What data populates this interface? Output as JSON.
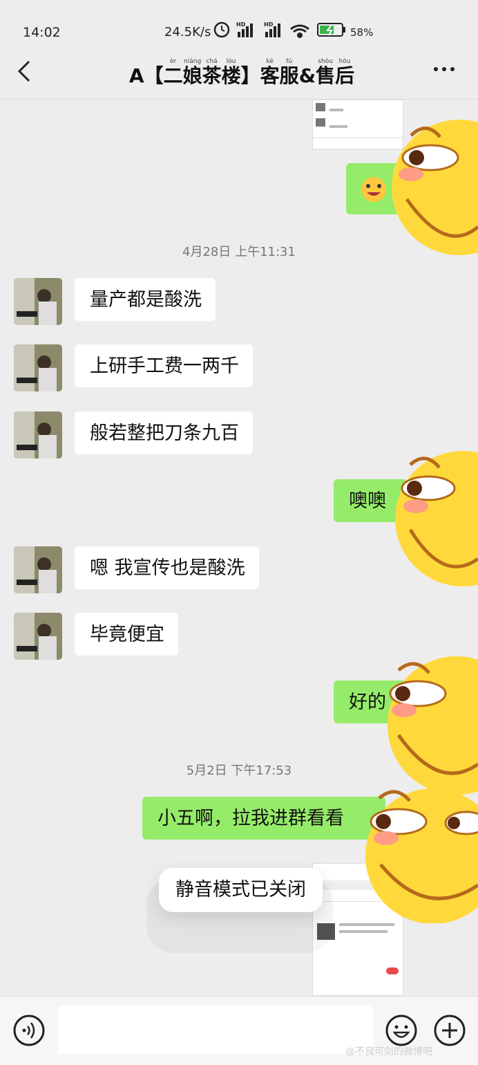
{
  "status_bar": {
    "time": "14:02",
    "net_speed": "24.5K/s",
    "battery": "58%"
  },
  "header": {
    "title_prefix": "A",
    "title_chars": [
      {
        "c": "【",
        "p": ""
      },
      {
        "c": "二",
        "p": "èr"
      },
      {
        "c": "娘",
        "p": "niáng"
      },
      {
        "c": "茶",
        "p": "chá"
      },
      {
        "c": "楼",
        "p": "lóu"
      },
      {
        "c": "】",
        "p": ""
      },
      {
        "c": "客",
        "p": "kè"
      },
      {
        "c": "服",
        "p": "fú"
      },
      {
        "c": "&",
        "p": ""
      },
      {
        "c": "售",
        "p": "shòu"
      },
      {
        "c": "后",
        "p": "hòu"
      }
    ]
  },
  "timestamps": {
    "t1": "4月28日 上午11:31",
    "t2": "5月2日 下午17:53"
  },
  "messages": [
    {
      "side": "left",
      "text": "量产都是酸洗"
    },
    {
      "side": "left",
      "text": "上研手工费一两千"
    },
    {
      "side": "left",
      "text": "般若整把刀条九百"
    },
    {
      "side": "right",
      "text": "噢噢"
    },
    {
      "side": "left",
      "text": "嗯  我宣传也是酸洗"
    },
    {
      "side": "left",
      "text": "毕竟便宜"
    },
    {
      "side": "right",
      "text": "好的"
    },
    {
      "side": "right",
      "text": "小五啊，拉我进群看看"
    }
  ],
  "toast": "静音模式已关闭",
  "watermark": "@不良可剑的微博吧",
  "colors": {
    "bubble_green": "#95ec69",
    "bg": "#ededed",
    "emoji_yellow": "#ffd93b"
  },
  "icons": [
    "back-arrow-icon",
    "more-icon",
    "voice-icon",
    "emoji-icon",
    "plus-icon"
  ]
}
